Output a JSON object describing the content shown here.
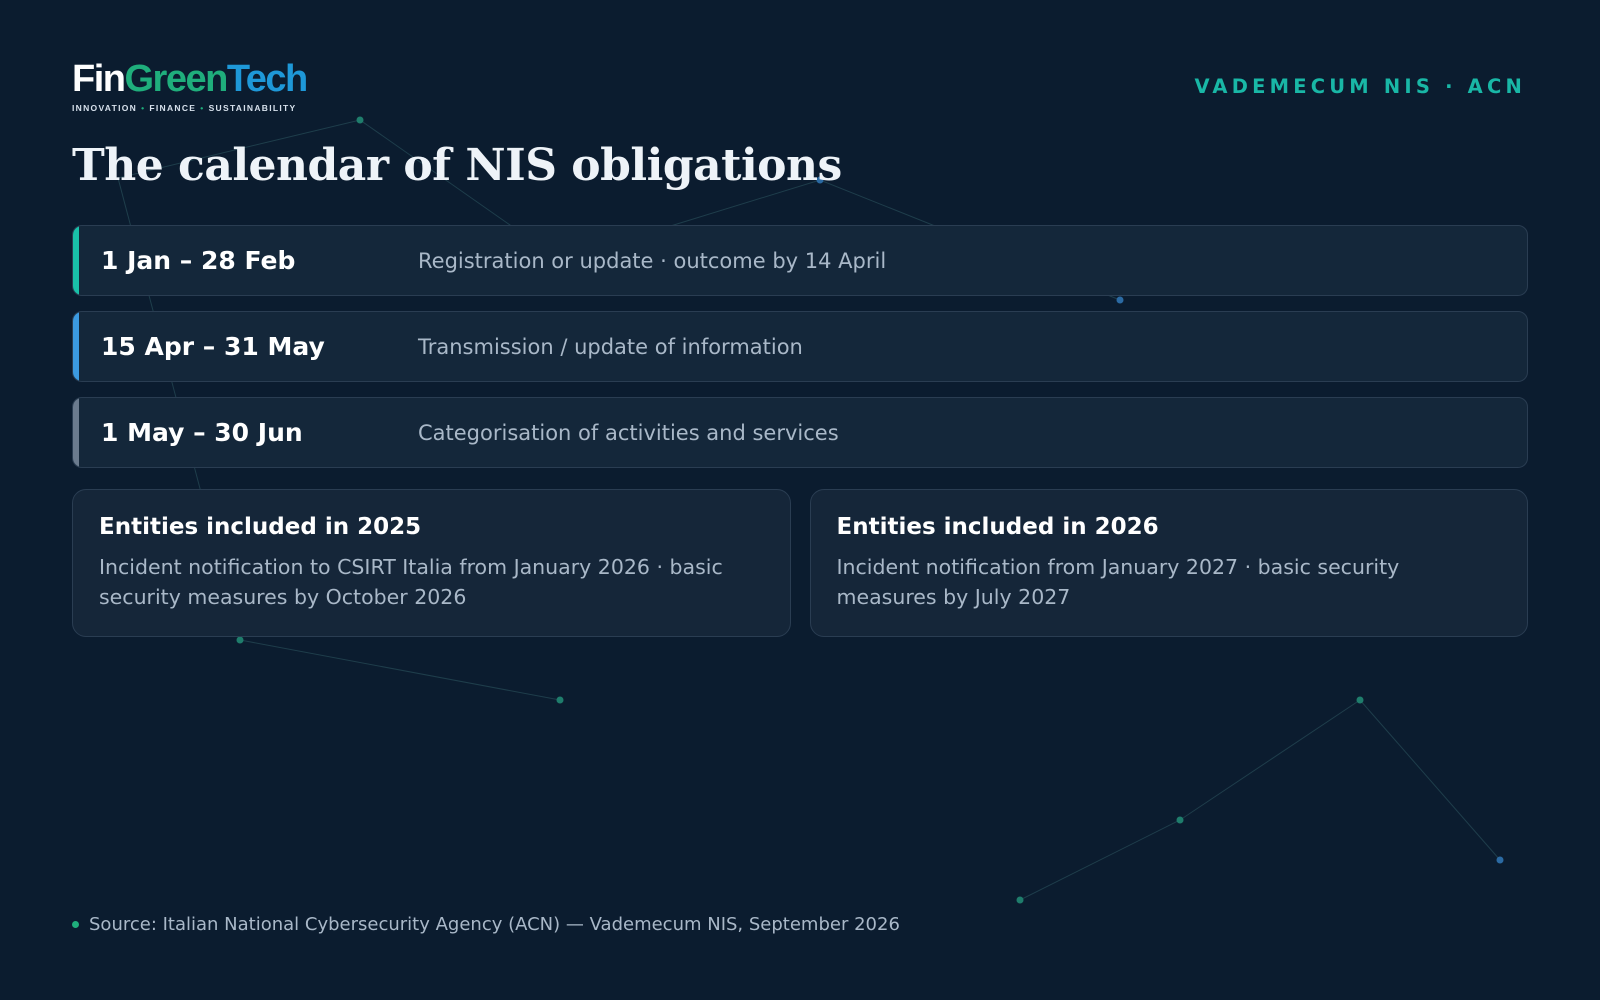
{
  "brand": {
    "fin": "Fin",
    "green": "Green",
    "tech": "Tech",
    "tagline_1": "INNOVATION",
    "tagline_2": "FINANCE",
    "tagline_3": "SUSTAINABILITY",
    "separator": "•"
  },
  "kicker": "VADEMECUM NIS · ACN",
  "title": "The calendar of NIS obligations",
  "timeline": [
    {
      "date": "1 Jan – 28 Feb",
      "description": "Registration or update · outcome by 14 April",
      "accent": "#19c1a9"
    },
    {
      "date": "15 Apr – 31 May",
      "description": "Transmission / update of information",
      "accent": "#3b9ae1"
    },
    {
      "date": "1 May – 30 Jun",
      "description": "Categorisation of activities and services",
      "accent": "#6b7b8e"
    }
  ],
  "cards": [
    {
      "title": "Entities included in 2025",
      "text": "Incident notification to CSIRT Italia from January 2026 · basic security measures by October 2026"
    },
    {
      "title": "Entities included in 2026",
      "text": "Incident notification from January 2027 · basic security measures by July 2027"
    }
  ],
  "source": "Source: Italian National Cybersecurity Agency (ACN) — Vademecum NIS, September 2026",
  "colors": {
    "background": "#0b1c2f",
    "brand_green": "#1fae7c",
    "brand_blue": "#1e98d8",
    "kicker": "#19b7a6"
  }
}
